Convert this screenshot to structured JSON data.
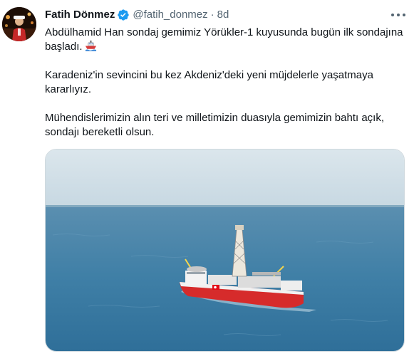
{
  "tweet": {
    "author_name": "Fatih Dönmez",
    "handle": "@fatih_donmez",
    "separator": "·",
    "time": "8d",
    "paragraphs": [
      "Abdülhamid Han sondaj gemimiz Yörükler-1 kuyusunda bugün ilk sondajına başladı.",
      "Karadeniz'in sevincini bu kez Akdeniz'deki yeni müjdelerle yaşatmaya kararlıyız.",
      "Mühendislerimizin alın teri ve milletimizin duasıyla gemimizin bahtı açık, sondajı bereketli olsun."
    ],
    "emoji": "ship-emoji",
    "avatar": "avatar-photo",
    "media": "drillship-at-sea-photo"
  },
  "colors": {
    "verified": "#1d9bf0",
    "text": "#0f1419",
    "muted": "#536471",
    "sea": "#3f7fa6",
    "ship_hull": "#d62b2b"
  },
  "icons": [
    "verified-badge-icon",
    "more-options-icon",
    "ship-emoji-icon"
  ]
}
